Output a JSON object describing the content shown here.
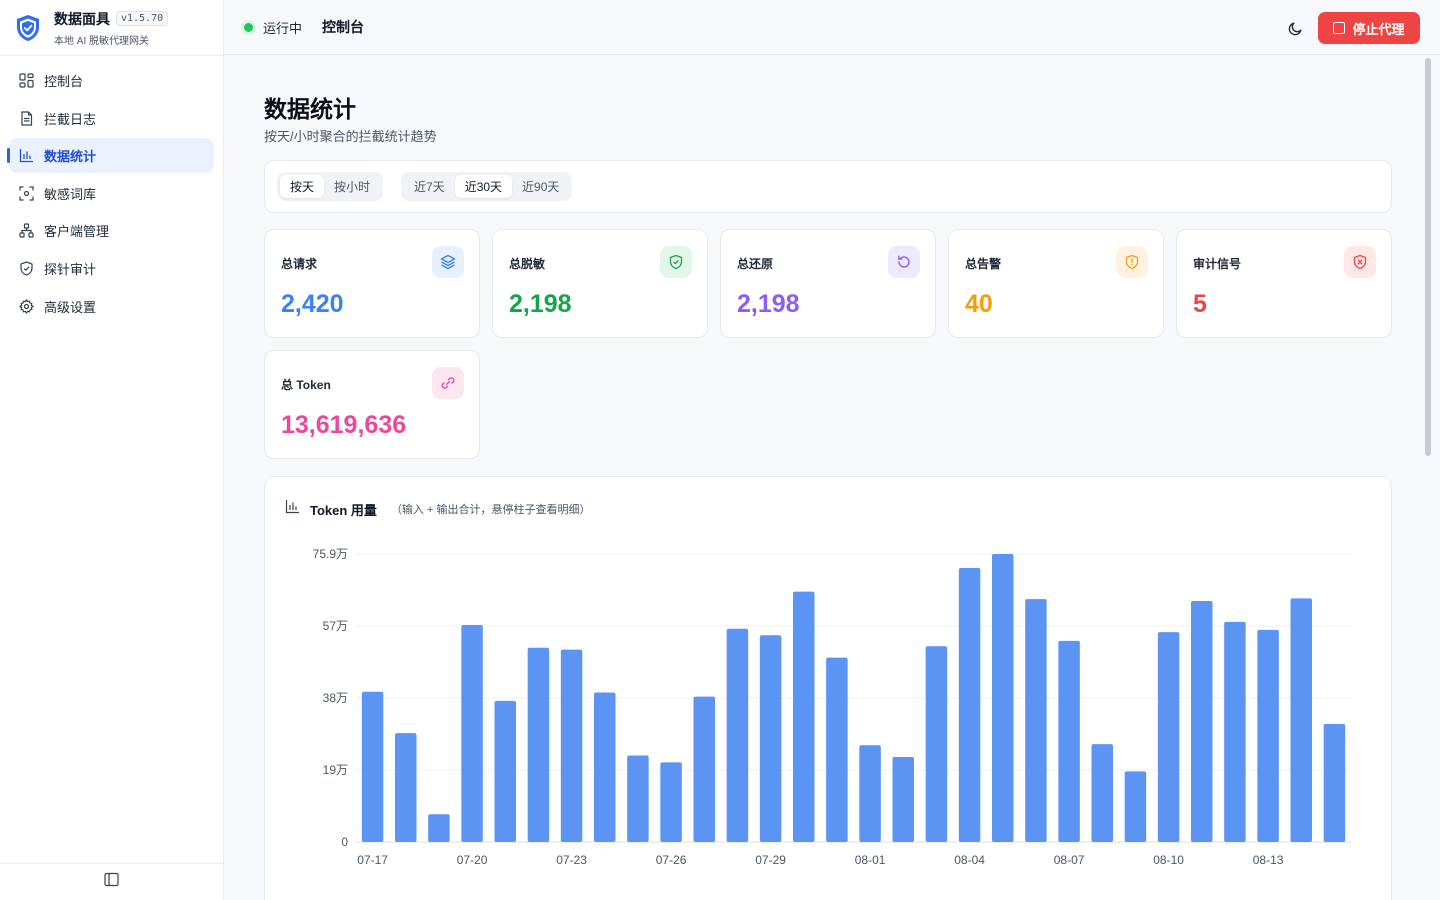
{
  "brand": {
    "name": "数据面具",
    "version": "v1.5.70",
    "subtitle": "本地 AI 脱敏代理网关"
  },
  "sidebar": {
    "items": [
      {
        "label": "控制台",
        "icon": "dashboard-icon",
        "active": false
      },
      {
        "label": "拦截日志",
        "icon": "document-icon",
        "active": false
      },
      {
        "label": "数据统计",
        "icon": "bar-chart-icon",
        "active": true
      },
      {
        "label": "敏感词库",
        "icon": "scan-icon",
        "active": false
      },
      {
        "label": "客户端管理",
        "icon": "network-icon",
        "active": false
      },
      {
        "label": "探针审计",
        "icon": "shield-check-icon",
        "active": false
      },
      {
        "label": "高级设置",
        "icon": "gear-icon",
        "active": false
      }
    ],
    "footer_icon": "sidebar-toggle-icon"
  },
  "topbar": {
    "status": "运行中",
    "status_color": "#22c55e",
    "title": "控制台",
    "theme_icon": "moon-icon",
    "stop_label": "停止代理",
    "stop_color": "#ef4444"
  },
  "page": {
    "title": "数据统计",
    "subtitle": "按天/小时聚合的拦截统计趋势"
  },
  "filters": {
    "granularity": [
      {
        "label": "按天",
        "selected": true
      },
      {
        "label": "按小时",
        "selected": false
      }
    ],
    "range": [
      {
        "label": "近7天",
        "selected": false
      },
      {
        "label": "近30天",
        "selected": true
      },
      {
        "label": "近90天",
        "selected": false
      }
    ]
  },
  "stats": [
    {
      "label": "总请求",
      "value": "2,420",
      "color": "#3b82f6",
      "icon": "layers-icon",
      "icon_bg": "#e7f0fe"
    },
    {
      "label": "总脱敏",
      "value": "2,198",
      "color": "#16a34a",
      "icon": "shield-check-icon",
      "icon_bg": "#e3f6ea"
    },
    {
      "label": "总还原",
      "value": "2,198",
      "color": "#8b5cf6",
      "icon": "rotate-ccw-icon",
      "icon_bg": "#efe9fd"
    },
    {
      "label": "总告警",
      "value": "40",
      "color": "#f59e0b",
      "icon": "shield-alert-icon",
      "icon_bg": "#fdf2e1"
    },
    {
      "label": "审计信号",
      "value": "5",
      "color": "#ef4444",
      "icon": "shield-x-icon",
      "icon_bg": "#fde7e7"
    },
    {
      "label": "总 Token",
      "value": "13,619,636",
      "color": "#ec4899",
      "icon": "link-icon",
      "icon_bg": "#fce7f1"
    }
  ],
  "chart": {
    "title": "Token 用量",
    "note": "（输入 + 输出合计，悬停柱子查看明细）",
    "icon": "bar-chart-icon"
  },
  "chart_data": {
    "type": "bar",
    "title": "Token 用量",
    "xlabel": "",
    "ylabel": "",
    "color": "#5b94f3",
    "grid": true,
    "ylim": [
      0,
      759000
    ],
    "ytick_labels": [
      "0",
      "19万",
      "38万",
      "57万",
      "75.9万"
    ],
    "xtick_labels": [
      "07-17",
      "07-20",
      "07-23",
      "07-26",
      "07-29",
      "08-01",
      "08-04",
      "08-07",
      "08-10",
      "08-13"
    ],
    "categories": [
      "07-17",
      "07-18",
      "07-19",
      "07-20",
      "07-21",
      "07-22",
      "07-23",
      "07-24",
      "07-25",
      "07-26",
      "07-27",
      "07-28",
      "07-29",
      "07-30",
      "07-31",
      "08-01",
      "08-02",
      "08-03",
      "08-04",
      "08-05",
      "08-06",
      "08-07",
      "08-08",
      "08-09",
      "08-10",
      "08-11",
      "08-12",
      "08-13",
      "08-14",
      "08-15"
    ],
    "values": [
      396000,
      287000,
      73000,
      572000,
      372000,
      512000,
      507000,
      394000,
      228000,
      210000,
      383000,
      562000,
      545000,
      660000,
      486000,
      255000,
      224000,
      516000,
      722000,
      759000,
      640000,
      530000,
      258000,
      186000,
      553000,
      635000,
      580000,
      559000,
      642000,
      311000
    ]
  }
}
